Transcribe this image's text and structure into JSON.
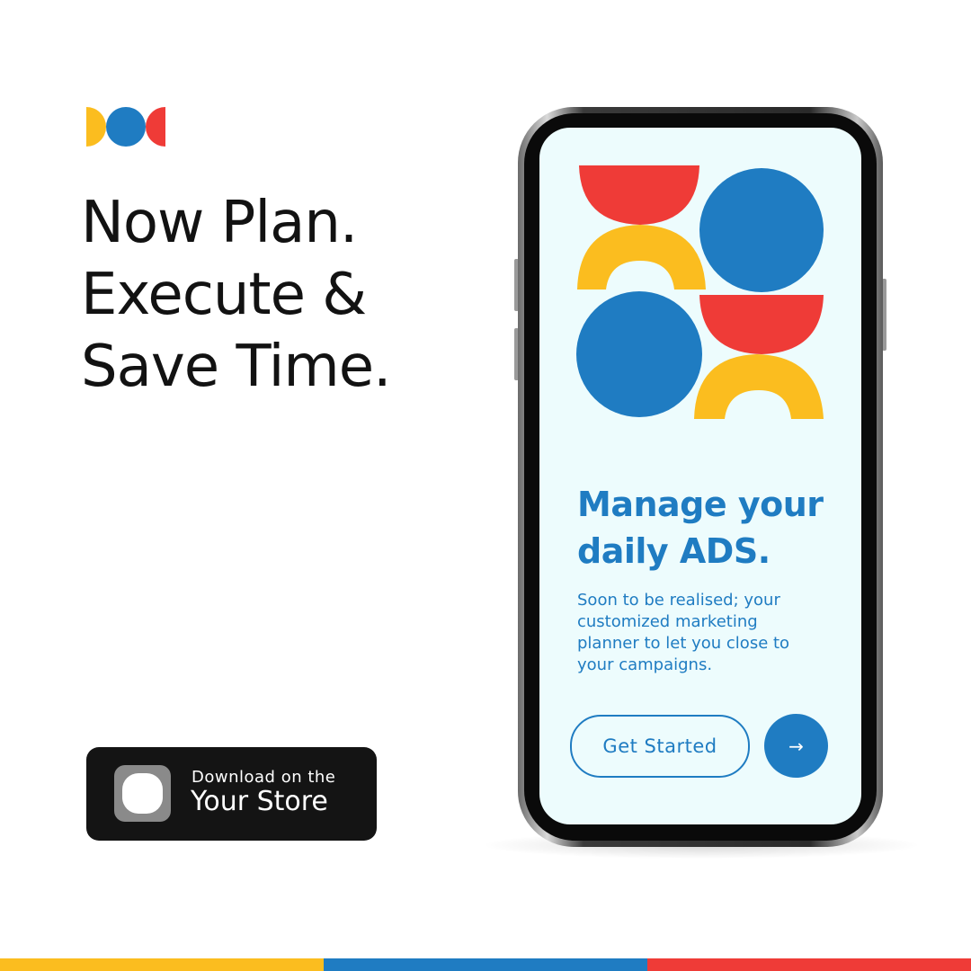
{
  "brand": {
    "logo_icon": "three-shape-logo-icon",
    "colors": {
      "yellow": "#fbbd1f",
      "blue": "#1f7cc2",
      "red": "#ef3b37"
    }
  },
  "headline": {
    "lines": [
      "Now Plan.",
      "Execute &",
      "Save Time."
    ]
  },
  "store_badge": {
    "small_text": "Download on the",
    "big_text": "Your Store",
    "icon": "store-app-icon"
  },
  "phone": {
    "screen": {
      "title_lines": [
        "Manage your",
        "daily ADS."
      ],
      "description_lines": [
        "Soon to be realised; your",
        "customized marketing",
        "planner to let you close to",
        "your campaigns."
      ],
      "primary_button_label": "Get Started",
      "next_button_icon": "arrow-right-icon",
      "next_button_glyph": "→"
    }
  },
  "bottom_bar": {
    "colors": [
      "#fbbd1f",
      "#1f7cc2",
      "#ef3b37"
    ]
  }
}
